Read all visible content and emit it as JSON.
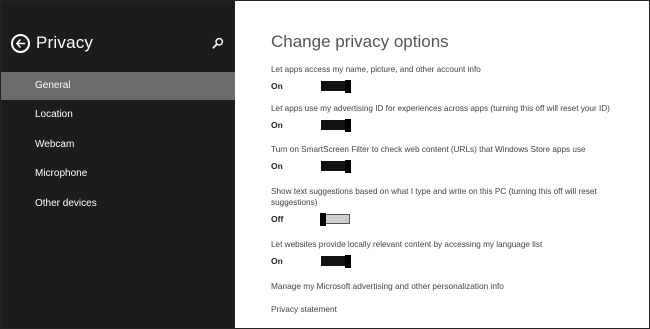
{
  "sidebar": {
    "title": "Privacy",
    "items": [
      {
        "label": "General",
        "active": true
      },
      {
        "label": "Location",
        "active": false
      },
      {
        "label": "Webcam",
        "active": false
      },
      {
        "label": "Microphone",
        "active": false
      },
      {
        "label": "Other devices",
        "active": false
      }
    ]
  },
  "main": {
    "title": "Change privacy options",
    "settings": [
      {
        "label": "Let apps access my name, picture, and other account info",
        "state": "On"
      },
      {
        "label": "Let apps use my advertising ID for experiences across apps (turning this off will reset your ID)",
        "state": "On"
      },
      {
        "label": "Turn on SmartScreen Filter to check web content (URLs) that Windows Store apps use",
        "state": "On"
      },
      {
        "label": "Show text suggestions based on what I type and write on this PC (turning this off will reset suggestions)",
        "state": "Off"
      },
      {
        "label": "Let websites provide locally relevant content by accessing my language list",
        "state": "On"
      }
    ],
    "links": [
      "Manage my Microsoft advertising and other personalization info",
      "Privacy statement"
    ]
  },
  "icons": {
    "back": "back-arrow-icon",
    "search": "search-icon"
  },
  "colors": {
    "sidebar_bg": "#1c1c1c",
    "active_item_bg": "#6b6b6b",
    "content_bg": "#ffffff"
  }
}
